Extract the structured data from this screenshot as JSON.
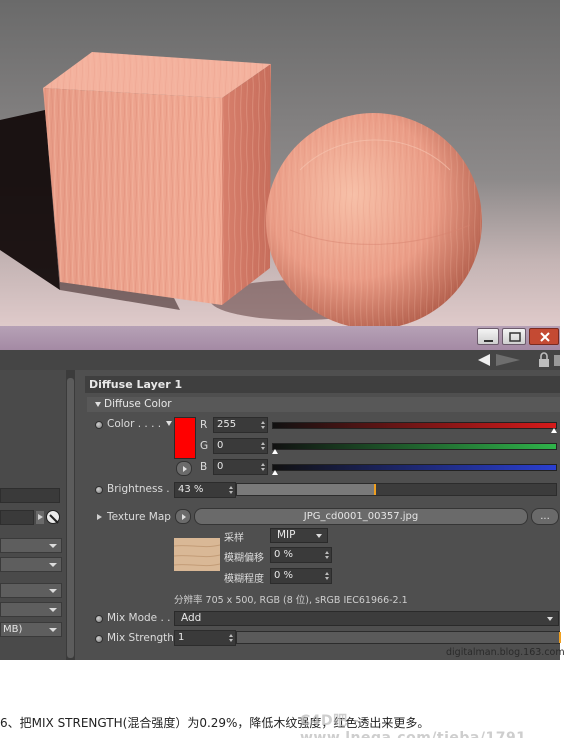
{
  "render": {
    "background_top": "#6c6c6c",
    "background_floor": "#d9c7c7",
    "material_color": "#e8a08a"
  },
  "window": {
    "minimize_icon": "minimize-icon",
    "restore_icon": "restore-icon",
    "close_icon": "close-icon",
    "close_color": "#c44a33"
  },
  "toolbar": {
    "icons": [
      "back-arrow-icon",
      "forward-arrow-icon",
      "lock-icon"
    ]
  },
  "left_panel": {
    "dropdown_partial_text": "MB)"
  },
  "material": {
    "layer_title": "Diffuse Layer 1",
    "section_title": "Diffuse Color",
    "color": {
      "label": "Color . . . .",
      "swatch": "#ff0000",
      "channels": [
        {
          "name": "R",
          "value": "255",
          "color": "#d61a1a",
          "level": 1.0
        },
        {
          "name": "G",
          "value": "0",
          "color": "#2fb34a",
          "level": 0.0
        },
        {
          "name": "B",
          "value": "0",
          "color": "#2a3fd1",
          "level": 0.0
        }
      ]
    },
    "brightness": {
      "label": "Brightness . .",
      "value": "43 %",
      "fill_fraction": 0.43
    },
    "texture_map": {
      "label": "Texture Map",
      "file": "JPG_cd0001_00357.jpg",
      "browse": "...",
      "sampling_label": "采样",
      "sampling_value": "MIP",
      "blur_offset_label": "模糊偏移",
      "blur_offset_value": "0 %",
      "blur_scale_label": "模糊程度",
      "blur_scale_value": "0 %",
      "info": "分辨率 705 x 500, RGB (8 位), sRGB IEC61966-2.1",
      "thumb_color": "#d9b896"
    },
    "mix_mode": {
      "label": "Mix Mode . .",
      "value": "Add"
    },
    "mix_strength": {
      "label": "Mix Strength",
      "value": "1",
      "level": 0.01
    }
  },
  "watermark_site": "digitalman.blog.163.com",
  "watermark_c4d": "C4D吧 - www.lnega.com/tieba/1791",
  "caption": "6、把MIX STRENGTH(混合强度）为0.29%，降低木纹强度，红色透出来更多。"
}
